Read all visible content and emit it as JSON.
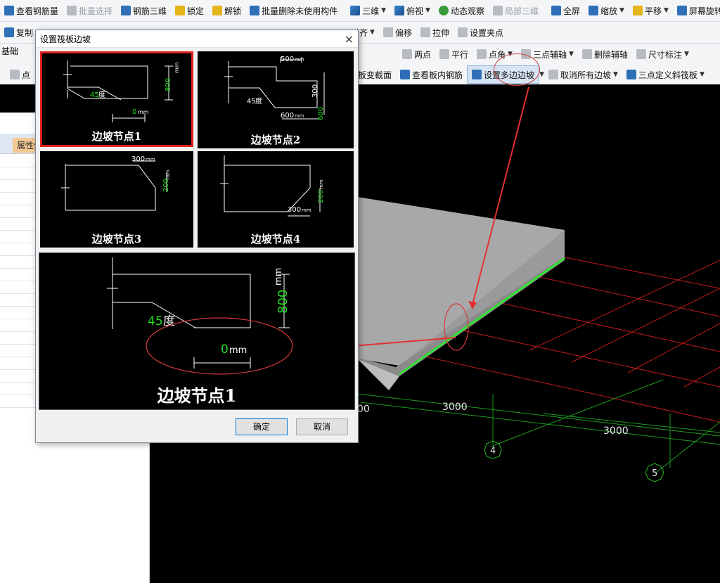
{
  "toolbar1": {
    "view_rebar_qty": "查看钢筋量",
    "batch_select": "批量选择",
    "rebar_3d": "钢筋三维",
    "lock": "锁定",
    "unlock": "解锁",
    "batch_delete_unused": "批量删除未使用构件",
    "three_d": "三维",
    "top_view": "俯视",
    "dynamic_observe": "动态观察",
    "local_3d": "局部三维",
    "full_screen": "全屏",
    "zoom": "缩放",
    "pan": "平移",
    "screen_rotate": "屏幕旋转"
  },
  "toolbar2": {
    "copy": "复制",
    "align": "对齐",
    "offset": "偏移",
    "stretch": "拉伸",
    "set_clip_point": "设置夹点"
  },
  "toolbar3": {
    "two_point": "两点",
    "parallel": "平行",
    "point_angle": "点角",
    "three_point_axis": "三点辅轴",
    "delete_axis": "删除辅轴",
    "dimension": "尺寸标注"
  },
  "toolbar4": {
    "point": "点",
    "raft_var_section": "查看筏板变截面",
    "view_inner_rebar": "查看板内钢筋",
    "set_multi_slope": "设置多边边坡",
    "cancel_all_slopes": "取消所有边坡",
    "three_point_slope": "三点定义斜筏板"
  },
  "left_panel": {
    "layer_label": "基础",
    "property_col": "属性值"
  },
  "viewport": {
    "dim1": "3000",
    "dim2": "3000",
    "dim_partial": "00",
    "axis_4": "4",
    "axis_5": "5"
  },
  "dialog": {
    "title": "设置筏板边坡",
    "close": "×",
    "node1": {
      "label": "边坡节点1",
      "angle_value": "45",
      "angle_unit": "度",
      "height_value": "800",
      "unit": "mm",
      "offset_value": "0"
    },
    "node2": {
      "label": "边坡节点2",
      "w1": "500",
      "h1": "300",
      "h2": "600",
      "w2": "600",
      "angle_value": "45",
      "angle_unit": "度",
      "unit": "mm"
    },
    "node3": {
      "label": "边坡节点3",
      "w": "300",
      "h": "200",
      "unit": "mm"
    },
    "node4": {
      "label": "边坡节点4",
      "w": "300",
      "h": "200",
      "unit": "mm"
    },
    "preview": {
      "label": "边坡节点1",
      "angle_value": "45",
      "angle_unit": "度",
      "height_value": "800",
      "offset_value": "0",
      "unit": "mm"
    },
    "ok": "确定",
    "cancel": "取消"
  },
  "colors": {
    "selected_border": "#e02020",
    "dim_green": "#22dd22",
    "annotation_red": "#d43a3a",
    "slab_top": "#a8a8a8",
    "slab_side": "#8c8c8c",
    "edge_green": "#22ee22"
  }
}
